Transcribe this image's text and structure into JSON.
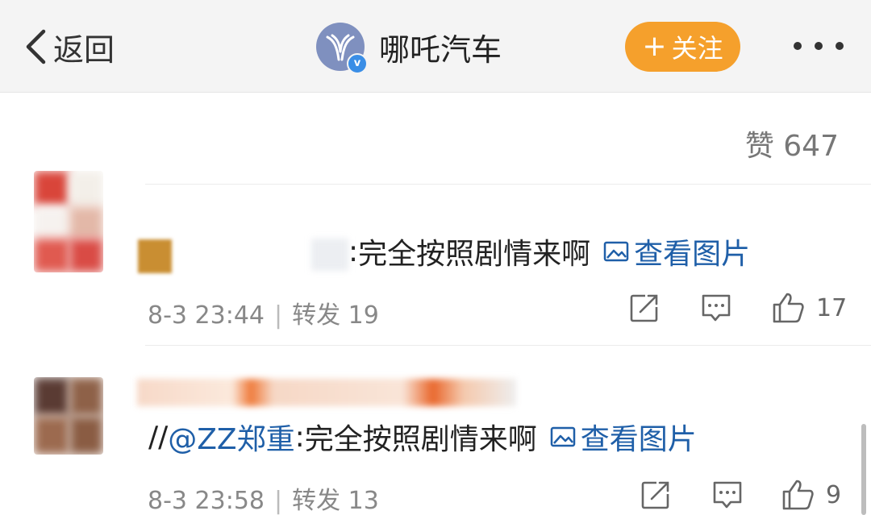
{
  "header": {
    "back_label": "返回",
    "account_name": "哪吒汽车",
    "follow_label": "关注",
    "follow_plus": "+",
    "verified_badge": "v",
    "accent_color": "#f5a02c"
  },
  "post_stats": {
    "likes_label": "赞 647"
  },
  "comments": [
    {
      "prefix": ":",
      "text": "完全按照剧情来啊",
      "view_image_label": "查看图片",
      "date": "8-3 23:44",
      "repost_label": "转发 19",
      "like_count": "17"
    },
    {
      "prefix": "//",
      "mention": "@ZZ郑重",
      "separator": ":",
      "text": "完全按照剧情来啊",
      "view_image_label": "查看图片",
      "date": "8-3 23:58",
      "repost_label": "转发 13",
      "like_count": "9"
    }
  ],
  "icons": {
    "back": "chevron-left-icon",
    "more": "more-dots-icon",
    "image": "image-icon",
    "repost": "repost-icon",
    "comment": "comment-icon",
    "like": "thumbs-up-icon"
  }
}
